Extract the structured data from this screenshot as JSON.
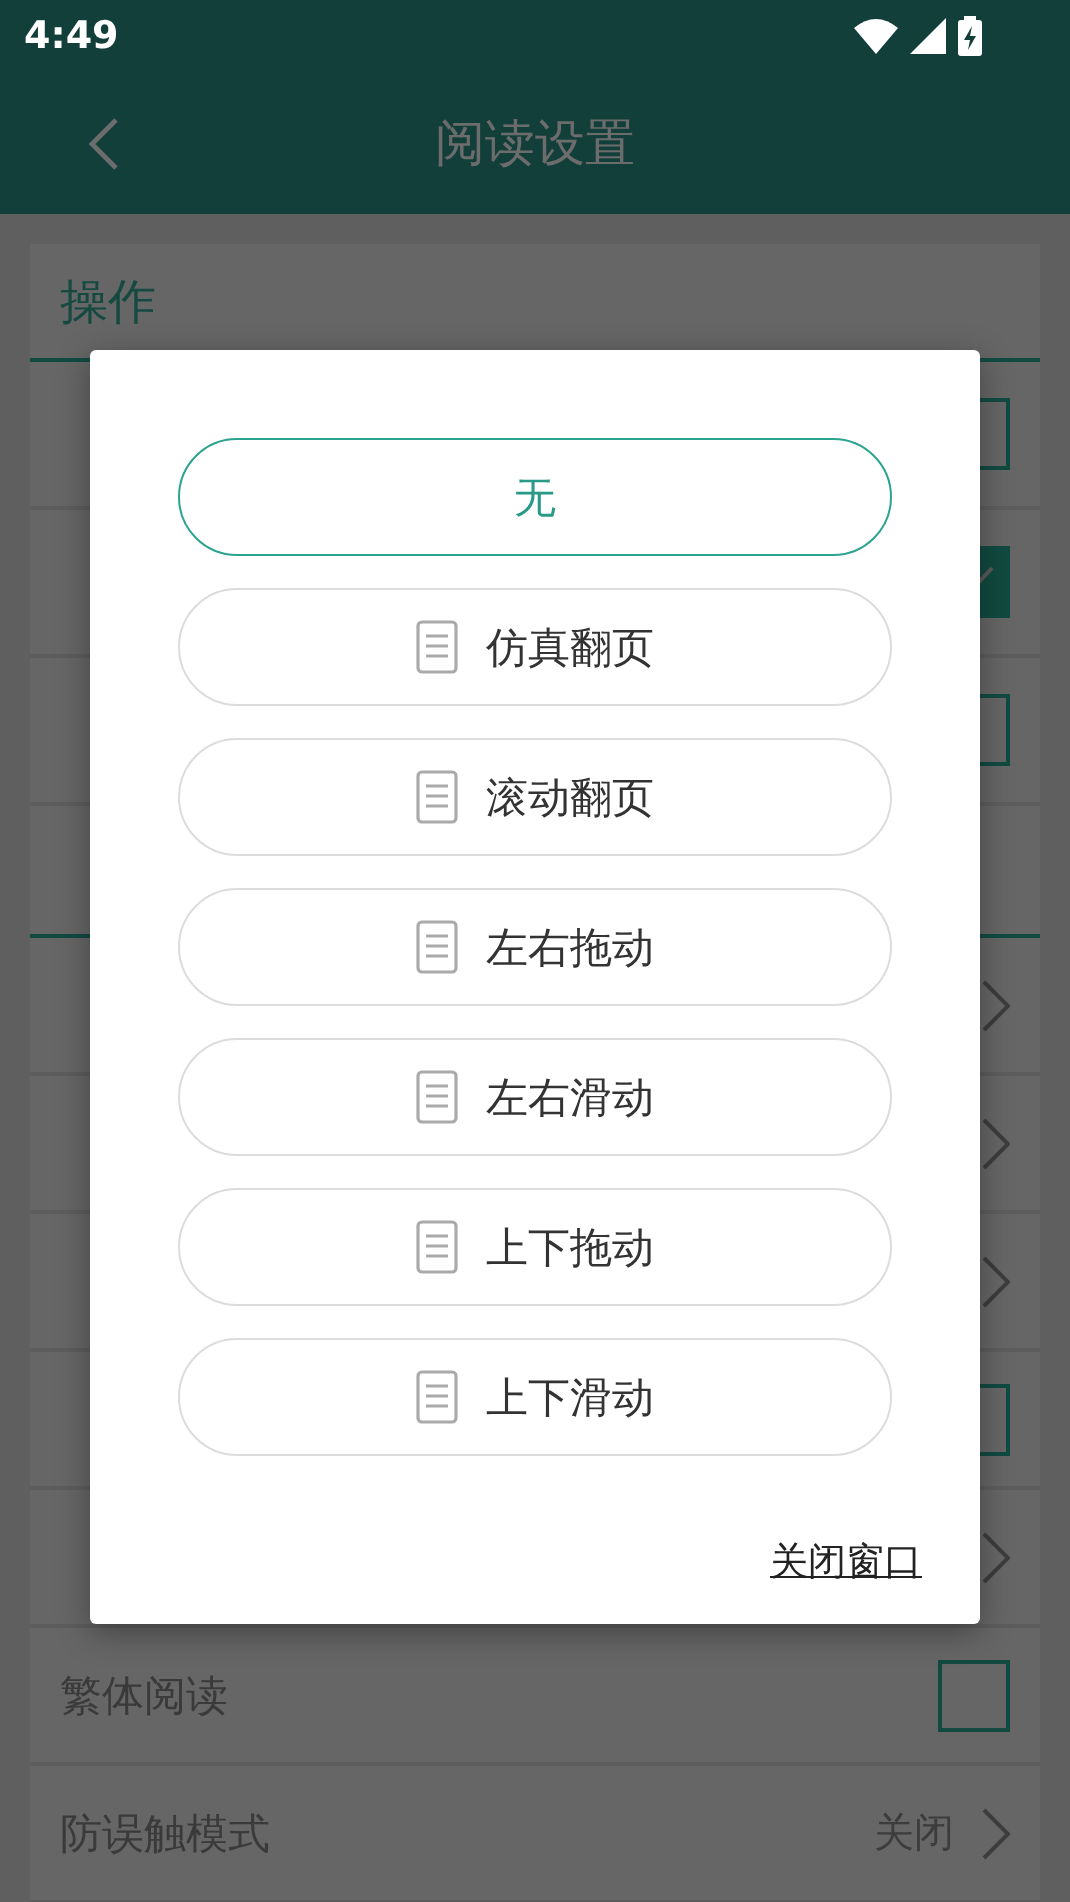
{
  "status_bar": {
    "time": "4:49"
  },
  "app_bar": {
    "title": "阅读设置"
  },
  "sections": [
    {
      "title": "操作",
      "rows": [
        {
          "kind": "checkbox",
          "checked": false
        },
        {
          "kind": "checkbox",
          "checked": true
        },
        {
          "kind": "checkbox",
          "checked": false
        }
      ]
    },
    {
      "rows": [
        {
          "kind": "chevron"
        },
        {
          "kind": "chevron"
        },
        {
          "kind": "chevron"
        },
        {
          "kind": "checkbox",
          "checked": false
        },
        {
          "kind": "chevron"
        },
        {
          "label": "繁体阅读",
          "kind": "checkbox",
          "checked": false
        },
        {
          "label": "防误触模式",
          "kind": "chevron",
          "value": "关闭"
        }
      ]
    }
  ],
  "dialog": {
    "options": [
      {
        "label": "无",
        "kind": "plain",
        "selected": true
      },
      {
        "label": "仿真翻页",
        "kind": "icon",
        "selected": false
      },
      {
        "label": "滚动翻页",
        "kind": "icon",
        "selected": false
      },
      {
        "label": "左右拖动",
        "kind": "icon",
        "selected": false
      },
      {
        "label": "左右滑动",
        "kind": "icon",
        "selected": false
      },
      {
        "label": "上下拖动",
        "kind": "icon",
        "selected": false
      },
      {
        "label": "上下滑动",
        "kind": "icon",
        "selected": false
      }
    ],
    "close_link": "关闭窗口"
  }
}
